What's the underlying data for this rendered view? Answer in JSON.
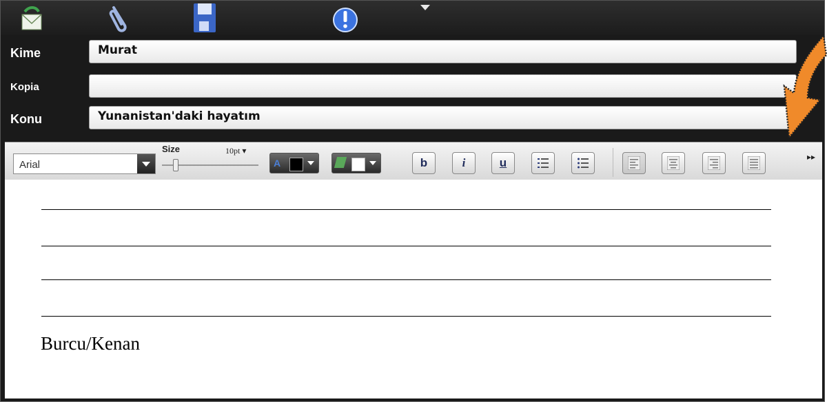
{
  "toolbar": {
    "icons": [
      "send-mail-icon",
      "attachment-icon",
      "save-icon",
      "priority-icon",
      "dropdown-arrow-icon"
    ]
  },
  "header": {
    "to_label": "Kime",
    "to_value": "Murat",
    "cc_label": "Kopia",
    "cc_value": "",
    "subject_label": "Konu",
    "subject_value": "Yunanistan'daki hayatım"
  },
  "format": {
    "font": "Arial",
    "size_label": "Size",
    "size_value": "10pt",
    "text_color": "#000000",
    "highlight_color": "#ffffff",
    "bold": "b",
    "italic": "i",
    "underline": "u",
    "more": "▸▸"
  },
  "body": {
    "signature": "Burcu/Kenan",
    "blank_lines": 4
  },
  "colors": {
    "toolbar_bg": "#1c1c1c",
    "arrow": "#f08a2a"
  }
}
